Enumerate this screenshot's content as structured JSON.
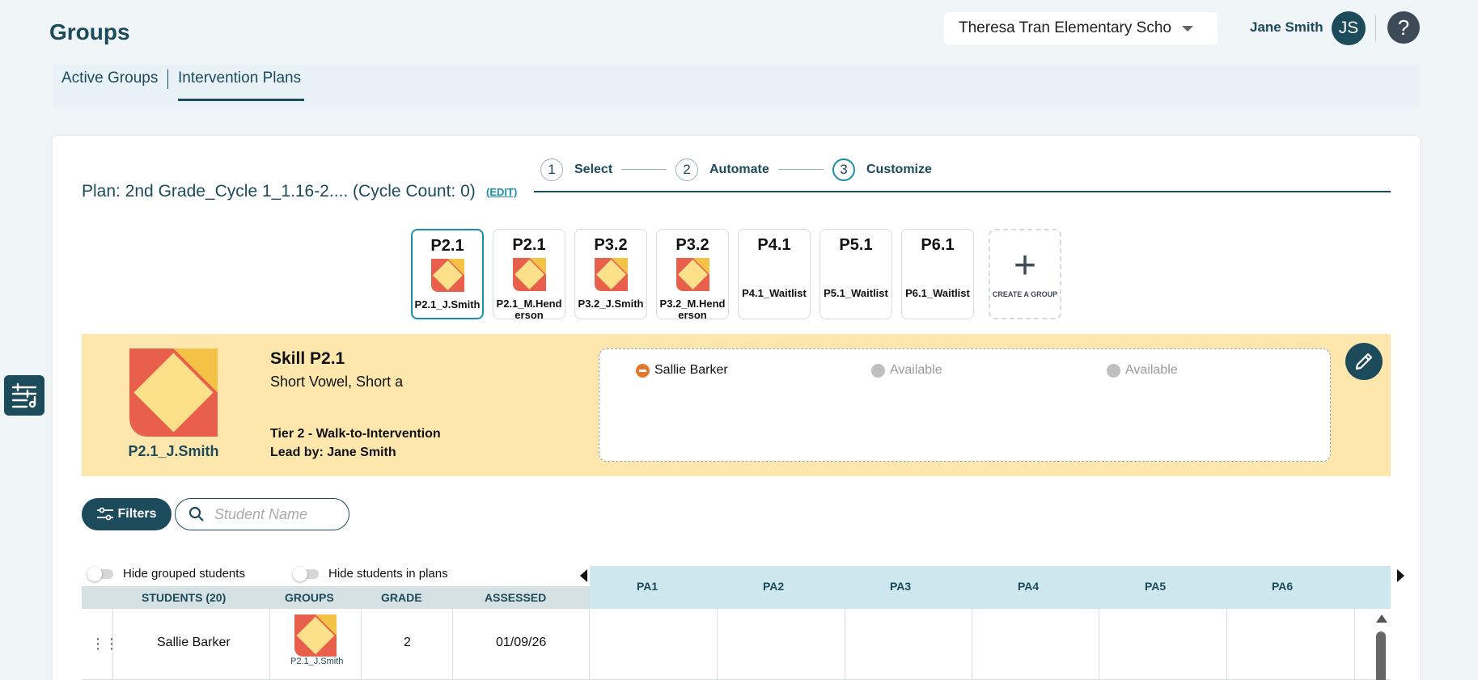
{
  "header": {
    "page_title": "Groups",
    "school_select": "Theresa Tran Elementary School",
    "user_name": "Jane Smith",
    "avatar_initials": "JS",
    "help_icon": "question-mark-icon"
  },
  "tabs": [
    {
      "label": "Active Groups",
      "active": false
    },
    {
      "label": "Intervention Plans",
      "active": true
    }
  ],
  "steps": [
    {
      "num": "1",
      "label": "Select"
    },
    {
      "num": "2",
      "label": "Automate"
    },
    {
      "num": "3",
      "label": "Customize",
      "active": true
    }
  ],
  "plan": {
    "title": "Plan: 2nd Grade_Cycle 1_1.16-2.... (Cycle Count: 0)",
    "edit_label": "(EDIT)"
  },
  "group_cards": [
    {
      "code": "P2.1",
      "name": "P2.1_J.Smith",
      "selected": true,
      "has_logo": true
    },
    {
      "code": "P2.1",
      "name": "P2.1_M.Henderson",
      "selected": false,
      "has_logo": true
    },
    {
      "code": "P3.2",
      "name": "P3.2_J.Smith",
      "selected": false,
      "has_logo": true
    },
    {
      "code": "P3.2",
      "name": "P3.2_M.Henderson",
      "selected": false,
      "has_logo": true
    },
    {
      "code": "P4.1",
      "name": "P4.1_Waitlist",
      "selected": false,
      "has_logo": false
    },
    {
      "code": "P5.1",
      "name": "P5.1_Waitlist",
      "selected": false,
      "has_logo": false
    },
    {
      "code": "P6.1",
      "name": "P6.1_Waitlist",
      "selected": false,
      "has_logo": false
    }
  ],
  "create_group_label": "CREATE A GROUP",
  "skill": {
    "group_name": "P2.1_J.Smith",
    "title": "Skill P2.1",
    "subtitle": "Short Vowel, Short a",
    "tier": "Tier 2 - Walk-to-Intervention",
    "lead": "Lead by: Jane Smith",
    "slots": [
      {
        "label": "Sallie Barker",
        "filled": true
      },
      {
        "label": "Available",
        "filled": false
      },
      {
        "label": "Available",
        "filled": false
      }
    ]
  },
  "filters_label": "Filters",
  "search": {
    "placeholder": "Student Name",
    "value": ""
  },
  "toggles": [
    {
      "label": "Hide grouped students",
      "on": false
    },
    {
      "label": "Hide students in plans",
      "on": false
    }
  ],
  "table": {
    "headers": [
      "STUDENTS (20)",
      "GROUPS",
      "GRADE",
      "ASSESSED"
    ],
    "pa_headers": [
      "PA1",
      "PA2",
      "PA3",
      "PA4",
      "PA5",
      "PA6"
    ],
    "rows": [
      {
        "student": "Sallie Barker",
        "group": "P2.1_J.Smith",
        "grade": "2",
        "assessed": "01/09/26"
      }
    ]
  },
  "colors": {
    "primary": "#1c4b5c",
    "accent": "#1a8fa8",
    "skill_panel_bg": "#fde7ad",
    "pa_header_bg": "#cfe7ef",
    "logo_red": "#e8604c",
    "logo_yellow": "#f4c245",
    "logo_cream": "#fde08a"
  }
}
